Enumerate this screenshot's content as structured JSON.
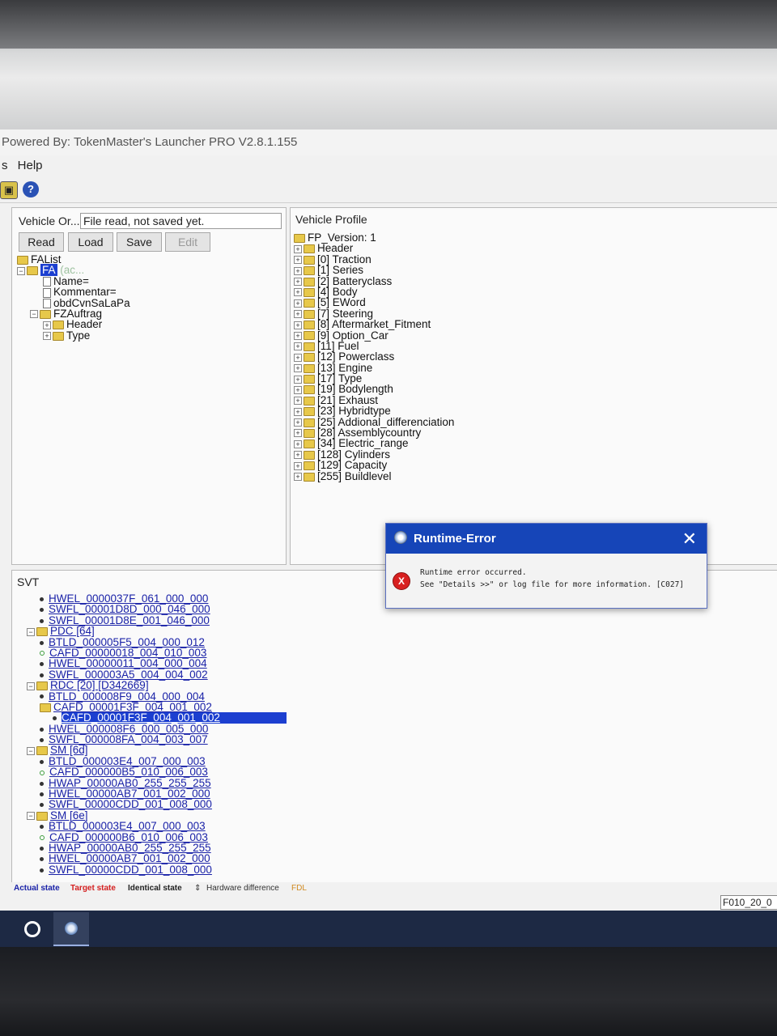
{
  "window": {
    "title": "Powered By: TokenMaster's Launcher PRO V2.8.1.155"
  },
  "menu": [
    "s",
    "Help"
  ],
  "toolbar": {
    "help_glyph": "?"
  },
  "left_panel": {
    "vehicle_order_label": "Vehicle Or...",
    "vehicle_order_value": "File read, not saved yet.",
    "buttons": {
      "read": "Read",
      "load": "Load",
      "save": "Save",
      "edit": "Edit"
    },
    "tree": {
      "root": "FAList",
      "fa": "FA",
      "fa_suffix": "(ac...",
      "name": "Name=",
      "kommentar": "Kommentar=",
      "obd": "obdCvnSaLaPa",
      "fzauftrag": "FZAuftrag",
      "header": "Header",
      "type": "Type"
    }
  },
  "right_panel": {
    "title": "Vehicle Profile",
    "root": "FP_Version: 1",
    "items": [
      "Header",
      "[0] Traction",
      "[1] Series",
      "[2] Batteryclass",
      "[4] Body",
      "[5] EWord",
      "[7] Steering",
      "[8] Aftermarket_Fitment",
      "[9] Option_Car",
      "[11] Fuel",
      "[12] Powerclass",
      "[13] Engine",
      "[17] Type",
      "[19] Bodylength",
      "[21] Exhaust",
      "[23] Hybridtype",
      "[25] Addional_differenciation",
      "[28] Assemblycountry",
      "[34] Electric_range",
      "[128] Cylinders",
      "[129] Capacity",
      "[255] Buildlevel"
    ]
  },
  "svt": {
    "title": "SVT",
    "rows": [
      {
        "kind": "item",
        "indent": 1,
        "bullet": "dark",
        "text": "HWEL_0000037F_061_000_000"
      },
      {
        "kind": "item",
        "indent": 1,
        "bullet": "dark",
        "text": "SWFL_00001D8D_000_046_000"
      },
      {
        "kind": "item",
        "indent": 1,
        "bullet": "dark",
        "text": "SWFL_00001D8E_001_046_000"
      },
      {
        "kind": "folder",
        "indent": 0,
        "text": "PDC [64]"
      },
      {
        "kind": "item",
        "indent": 1,
        "bullet": "dark",
        "text": "BTLD_000005F5_004_000_012"
      },
      {
        "kind": "item",
        "indent": 1,
        "bullet": "green",
        "text": "CAFD_00000018_004_010_003"
      },
      {
        "kind": "item",
        "indent": 1,
        "bullet": "dark",
        "text": "HWEL_00000011_004_000_004"
      },
      {
        "kind": "item",
        "indent": 1,
        "bullet": "dark",
        "text": "SWFL_000003A5_004_004_002"
      },
      {
        "kind": "folder",
        "indent": 0,
        "text": "RDC [20] [D342669]"
      },
      {
        "kind": "item",
        "indent": 1,
        "bullet": "dark",
        "text": "BTLD_000008F9_004_000_004"
      },
      {
        "kind": "subfolder",
        "indent": 1,
        "text": "CAFD_00001F3F_004_001_002"
      },
      {
        "kind": "selected",
        "indent": 2,
        "bullet": "dark",
        "text": "CAFD_00001F3F_004_001_002"
      },
      {
        "kind": "item",
        "indent": 1,
        "bullet": "dark",
        "text": "HWEL_000008F6_000_005_000"
      },
      {
        "kind": "item",
        "indent": 1,
        "bullet": "dark",
        "text": "SWFL_000008FA_004_003_007"
      },
      {
        "kind": "folder",
        "indent": 0,
        "text": "SM [6d]"
      },
      {
        "kind": "item",
        "indent": 1,
        "bullet": "dark",
        "text": "BTLD_000003E4_007_000_003"
      },
      {
        "kind": "item",
        "indent": 1,
        "bullet": "green",
        "text": "CAFD_000000B5_010_006_003"
      },
      {
        "kind": "item",
        "indent": 1,
        "bullet": "dark",
        "text": "HWAP_00000AB0_255_255_255"
      },
      {
        "kind": "item",
        "indent": 1,
        "bullet": "dark",
        "text": "HWEL_00000AB7_001_002_000"
      },
      {
        "kind": "item",
        "indent": 1,
        "bullet": "dark",
        "text": "SWFL_00000CDD_001_008_000"
      },
      {
        "kind": "folder",
        "indent": 0,
        "text": "SM [6e]"
      },
      {
        "kind": "item",
        "indent": 1,
        "bullet": "dark",
        "text": "BTLD_000003E4_007_000_003"
      },
      {
        "kind": "item",
        "indent": 1,
        "bullet": "green",
        "text": "CAFD_000000B6_010_006_003"
      },
      {
        "kind": "item",
        "indent": 1,
        "bullet": "dark",
        "text": "HWAP_00000AB0_255_255_255"
      },
      {
        "kind": "item",
        "indent": 1,
        "bullet": "dark",
        "text": "HWEL_00000AB7_001_002_000"
      },
      {
        "kind": "item",
        "indent": 1,
        "bullet": "dark",
        "text": "SWFL_00000CDD_001_008_000"
      }
    ]
  },
  "legend": {
    "actual": "Actual state",
    "target": "Target state",
    "identical": "Identical state",
    "hw_diff": "Hardware difference",
    "fdl": "FDL",
    "colors": {
      "actual": "#1a22a8",
      "target": "#d42020",
      "identical": "#222222",
      "hw_diff": "#333333",
      "fdl": "#d08a20"
    }
  },
  "status_right": "F010_20_0",
  "dialog": {
    "title": "Runtime-Error",
    "close_glyph": "✕",
    "error_glyph": "X",
    "line1": "Runtime error occurred.",
    "line2": "See \"Details >>\" or log file for more information. [C027]"
  },
  "colors": {
    "accent": "#1645b8",
    "selection": "#1c3fd0",
    "link": "#1a22a8",
    "taskbar": "#1d2944"
  }
}
